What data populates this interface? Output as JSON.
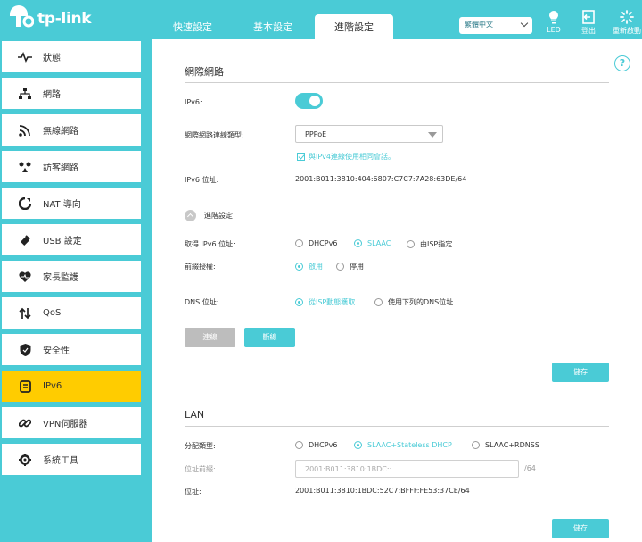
{
  "brand": {
    "logo_text": "tp-link"
  },
  "header": {
    "tabs": [
      {
        "label": "快速設定"
      },
      {
        "label": "基本設定"
      },
      {
        "label": "進階設定"
      }
    ],
    "language": "繁體中文",
    "led_label": "LED",
    "logout_label": "登出",
    "reboot_label": "重新啟動"
  },
  "sidebar": {
    "items": [
      {
        "label": "狀態",
        "icon": "pulse-icon"
      },
      {
        "label": "網路",
        "icon": "network-icon"
      },
      {
        "label": "無線網路",
        "icon": "wifi-icon"
      },
      {
        "label": "訪客網路",
        "icon": "guest-icon"
      },
      {
        "label": "NAT 導向",
        "icon": "nat-icon"
      },
      {
        "label": "USB 設定",
        "icon": "usb-icon"
      },
      {
        "label": "家長監護",
        "icon": "heart-icon"
      },
      {
        "label": "QoS",
        "icon": "qos-icon"
      },
      {
        "label": "安全性",
        "icon": "shield-icon"
      },
      {
        "label": "IPv6",
        "icon": "ipv6-icon"
      },
      {
        "label": "VPN伺服器",
        "icon": "vpn-icon"
      },
      {
        "label": "系統工具",
        "icon": "gear-icon"
      }
    ],
    "active_index": 9
  },
  "internet": {
    "title": "網際網路",
    "ipv6_label": "IPv6:",
    "ipv6_enabled": true,
    "conn_type_label": "網際網路連線類型:",
    "conn_type_value": "PPPoE",
    "same_session_label": "與IPv4連線使用相同會話。",
    "ipv6_addr_label": "IPv6 位址:",
    "ipv6_addr_value": "2001:B011:3810:404:6807:C7C7:7A28:63DE/64",
    "advanced_label": "進階設定",
    "get_addr_label": "取得 IPv6 位址:",
    "get_addr_options": [
      "DHCPv6",
      "SLAAC",
      "由ISP指定"
    ],
    "prefix_label": "前綴授權:",
    "prefix_options": [
      "啟用",
      "停用"
    ],
    "dns_label": "DNS 位址:",
    "dns_options": [
      "從ISP動態獲取",
      "使用下列的DNS位址"
    ],
    "connect_button": "連線",
    "disconnect_button": "斷線",
    "save_button": "儲存"
  },
  "lan": {
    "title": "LAN",
    "assign_type_label": "分配類型:",
    "assign_options": [
      "DHCPv6",
      "SLAAC+Stateless DHCP",
      "SLAAC+RDNSS"
    ],
    "prefix_label": "位址前綴:",
    "prefix_placeholder": "2001:B011:3810:1BDC::",
    "prefix_suffix": "/64",
    "address_label": "位址:",
    "address_value": "2001:B011:3810:1BDC:52C7:BFFF:FE53:37CE/64",
    "save_button": "儲存"
  },
  "colors": {
    "accent": "#4acbd6",
    "active_nav": "#ffcc00"
  }
}
